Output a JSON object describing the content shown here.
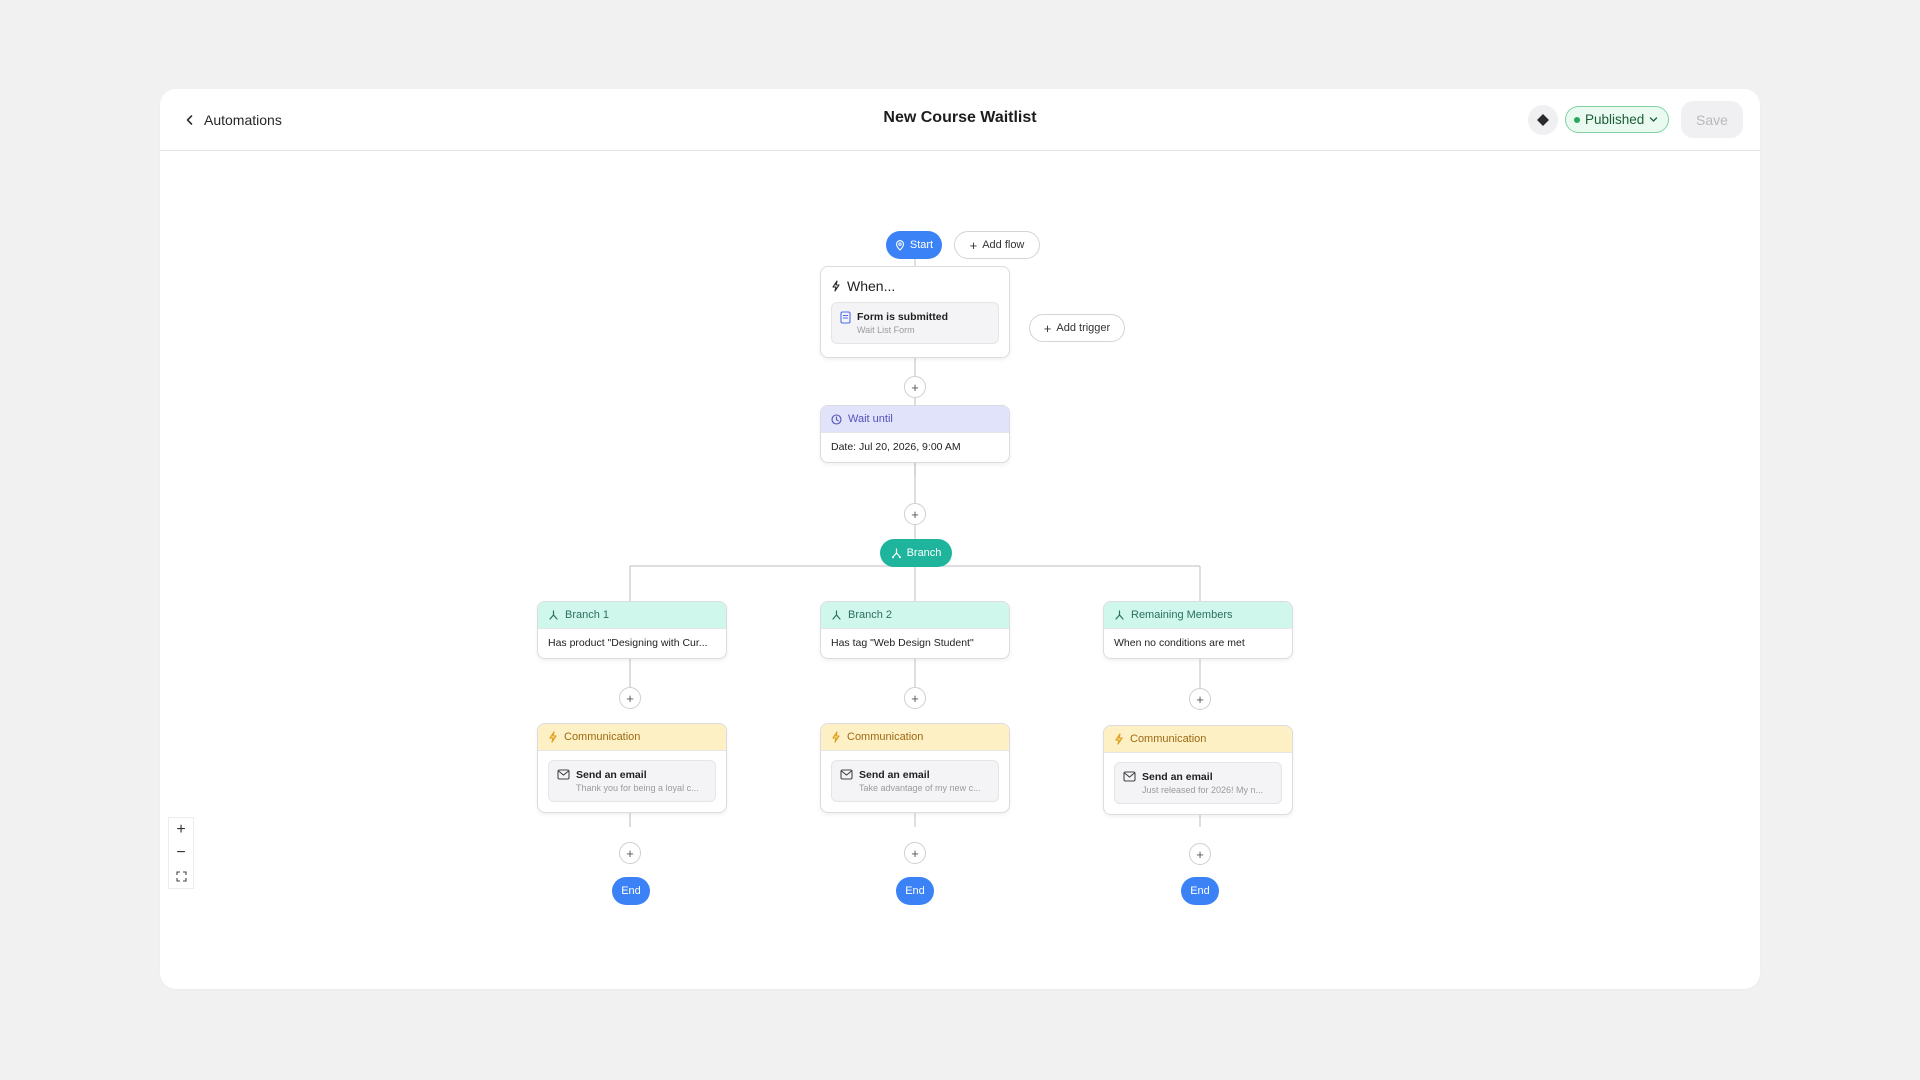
{
  "header": {
    "back_label": "Automations",
    "title": "New Course Waitlist",
    "status_label": "Published",
    "save_label": "Save"
  },
  "flow": {
    "start_label": "Start",
    "add_flow_label": "Add flow",
    "add_trigger_label": "Add trigger",
    "trigger": {
      "heading": "When...",
      "title": "Form is submitted",
      "subtitle": "Wait List Form"
    },
    "wait": {
      "heading": "Wait until",
      "detail": "Date: Jul 20, 2026, 9:00 AM"
    },
    "branch_label": "Branch",
    "branches": [
      {
        "heading": "Branch 1",
        "condition": "Has product \"Designing with Cur...",
        "action_heading": "Communication",
        "action_title": "Send an email",
        "action_subtitle": "Thank you for being a loyal c...",
        "end_label": "End"
      },
      {
        "heading": "Branch 2",
        "condition": "Has tag \"Web Design Student\"",
        "action_heading": "Communication",
        "action_title": "Send an email",
        "action_subtitle": "Take advantage of my new c...",
        "end_label": "End"
      },
      {
        "heading": "Remaining Members",
        "condition": "When no conditions are met",
        "action_heading": "Communication",
        "action_title": "Send an email",
        "action_subtitle": "Just released for 2026! My n...",
        "end_label": "End"
      }
    ]
  },
  "zoom_controls": {
    "zoom_in": "+",
    "zoom_out": "−"
  },
  "colors": {
    "accent_blue": "#3b82f6",
    "branch_green": "#1fb59c",
    "published_green": "#27a85a",
    "wait_purple": "#e1e3fb",
    "branch_teal": "#d0f7ec",
    "communication_yellow": "#fdf0c5"
  }
}
